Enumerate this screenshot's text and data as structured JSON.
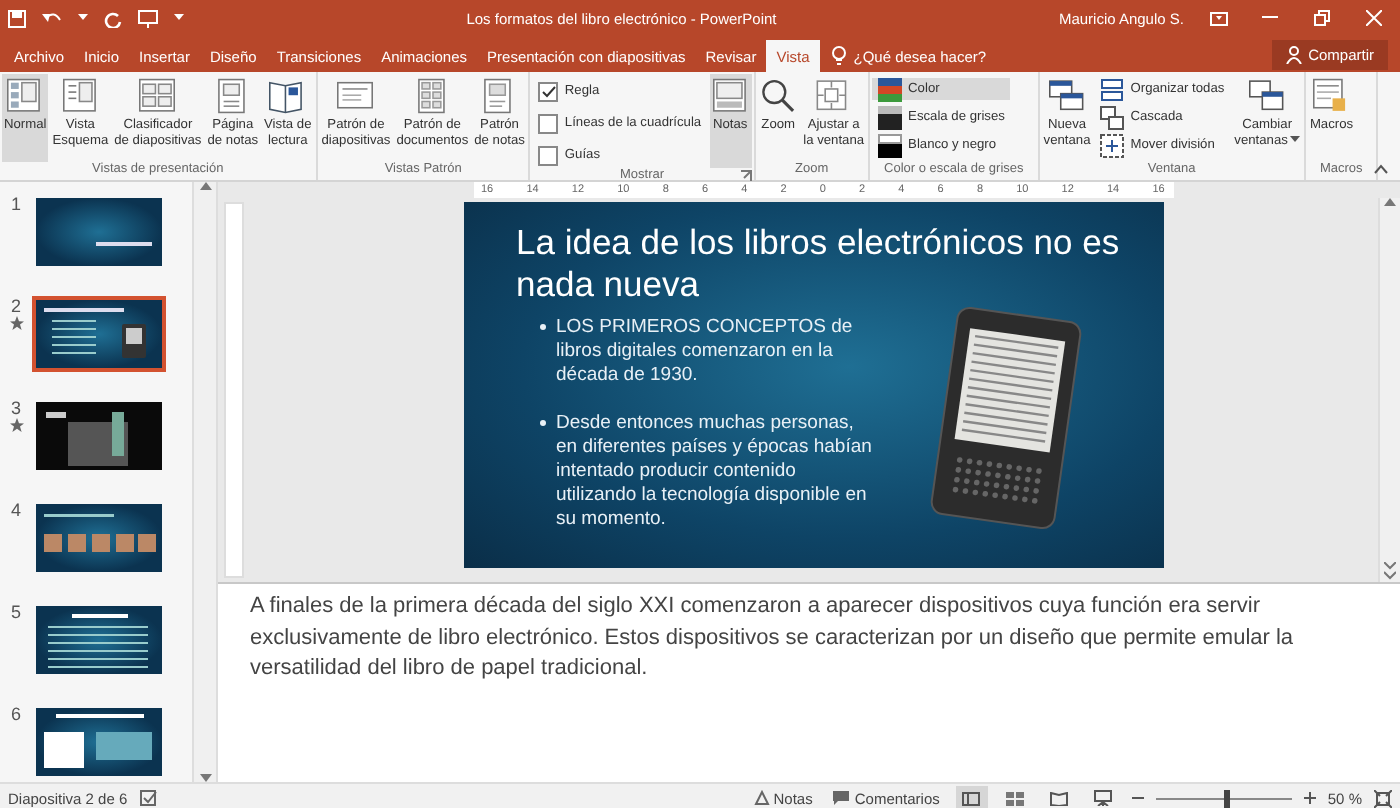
{
  "window": {
    "title": "Los formatos del libro electrónico - PowerPoint",
    "user": "Mauricio Angulo S."
  },
  "tabs": [
    {
      "label": "Archivo",
      "selected": false
    },
    {
      "label": "Inicio",
      "selected": false
    },
    {
      "label": "Insertar",
      "selected": false
    },
    {
      "label": "Diseño",
      "selected": false
    },
    {
      "label": "Transiciones",
      "selected": false
    },
    {
      "label": "Animaciones",
      "selected": false
    },
    {
      "label": "Presentación con diapositivas",
      "selected": false
    },
    {
      "label": "Revisar",
      "selected": false
    },
    {
      "label": "Vista",
      "selected": true
    }
  ],
  "tell_me": {
    "placeholder": "¿Qué desea hacer?"
  },
  "share_button": "Compartir",
  "ribbon": [
    {
      "label": "Vistas de presentación",
      "launcher": false,
      "items": [
        {
          "kind": "large",
          "lines": [
            "Normal"
          ],
          "selected": true,
          "dropdown": false
        },
        {
          "kind": "large",
          "lines": [
            "Vista",
            "Esquema"
          ],
          "selected": false,
          "dropdown": false
        },
        {
          "kind": "large",
          "lines": [
            "Clasificador",
            "de diapositivas"
          ],
          "selected": false,
          "dropdown": false
        },
        {
          "kind": "large",
          "lines": [
            "Página",
            "de notas"
          ],
          "selected": false,
          "dropdown": false
        },
        {
          "kind": "large",
          "lines": [
            "Vista de",
            "lectura"
          ],
          "selected": false,
          "dropdown": false
        }
      ]
    },
    {
      "label": "Vistas Patrón",
      "launcher": false,
      "items": [
        {
          "kind": "large",
          "lines": [
            "Patrón de",
            "diapositivas"
          ],
          "selected": false,
          "dropdown": false
        },
        {
          "kind": "large",
          "lines": [
            "Patrón de",
            "documentos"
          ],
          "selected": false,
          "dropdown": false
        },
        {
          "kind": "large",
          "lines": [
            "Patrón",
            "de notas"
          ],
          "selected": false,
          "dropdown": false
        }
      ]
    },
    {
      "label": "Mostrar",
      "launcher": true,
      "items": [
        {
          "kind": "column",
          "entries": [
            {
              "kind": "check",
              "label": "Regla",
              "checked": true
            },
            {
              "kind": "check",
              "label": "Líneas de la cuadrícula",
              "checked": false
            },
            {
              "kind": "check",
              "label": "Guías",
              "checked": false
            }
          ]
        },
        {
          "kind": "large",
          "lines": [
            "Notas"
          ],
          "selected": true,
          "dropdown": false
        }
      ]
    },
    {
      "label": "Zoom",
      "launcher": false,
      "items": [
        {
          "kind": "large",
          "lines": [
            "Zoom"
          ],
          "selected": false,
          "dropdown": false
        },
        {
          "kind": "large",
          "lines": [
            "Ajustar a",
            "la ventana"
          ],
          "selected": false,
          "dropdown": false
        }
      ]
    },
    {
      "label": "Color o escala de grises",
      "launcher": false,
      "items": [
        {
          "kind": "column",
          "entries": [
            {
              "kind": "small",
              "label": "Color",
              "selected": true
            },
            {
              "kind": "small",
              "label": "Escala de grises",
              "selected": false
            },
            {
              "kind": "small",
              "label": "Blanco y negro",
              "selected": false
            }
          ]
        }
      ]
    },
    {
      "label": "Ventana",
      "launcher": false,
      "items": [
        {
          "kind": "large",
          "lines": [
            "Nueva",
            "ventana"
          ],
          "selected": false,
          "dropdown": false
        },
        {
          "kind": "column",
          "entries": [
            {
              "kind": "small",
              "label": "Organizar todas",
              "selected": false
            },
            {
              "kind": "small",
              "label": "Cascada",
              "selected": false
            },
            {
              "kind": "small",
              "label": "Mover división",
              "selected": false
            }
          ]
        },
        {
          "kind": "large",
          "lines": [
            "Cambiar",
            "ventanas"
          ],
          "selected": false,
          "dropdown": true
        }
      ]
    },
    {
      "label": "Macros",
      "launcher": false,
      "items": [
        {
          "kind": "large",
          "lines": [
            "Macros"
          ],
          "selected": false,
          "dropdown": false
        }
      ]
    }
  ],
  "ruler": [
    "16",
    "14",
    "12",
    "10",
    "8",
    "6",
    "4",
    "2",
    "0",
    "2",
    "4",
    "6",
    "8",
    "10",
    "12",
    "14",
    "16"
  ],
  "slides": [
    {
      "number": "1",
      "kind": "title",
      "selected": false,
      "animated": false
    },
    {
      "number": "2",
      "kind": "device",
      "selected": true,
      "animated": true
    },
    {
      "number": "3",
      "kind": "photo",
      "selected": false,
      "animated": true
    },
    {
      "number": "4",
      "kind": "images",
      "selected": false,
      "animated": false
    },
    {
      "number": "5",
      "kind": "text",
      "selected": false,
      "animated": false
    },
    {
      "number": "6",
      "kind": "chart",
      "selected": false,
      "animated": false
    }
  ],
  "slide": {
    "title": "La idea de los libros electrónicos no es nada nueva",
    "bullets": [
      "LOS PRIMEROS CONCEPTOS de libros digitales comenzaron en la década de 1930.",
      "Desde entonces muchas personas, en diferentes países y épocas habían intentado producir contenido utilizando la tecnología disponible en su momento."
    ]
  },
  "notes": "A finales de la primera década del siglo XXI comenzaron a aparecer dispositivos cuya función era servir exclusivamente de libro electrónico. Estos dispositivos se caracterizan por un diseño que permite emular la versatilidad del libro de papel tradicional.",
  "status_bar": {
    "slide_info": "Diapositiva 2 de 6",
    "notes_button": "Notas",
    "comments_button": "Comentarios",
    "views": [
      {
        "selected": true
      },
      {
        "selected": false
      },
      {
        "selected": false
      },
      {
        "selected": false
      }
    ],
    "zoom": {
      "level": 0.5,
      "reading": "50 %"
    }
  }
}
